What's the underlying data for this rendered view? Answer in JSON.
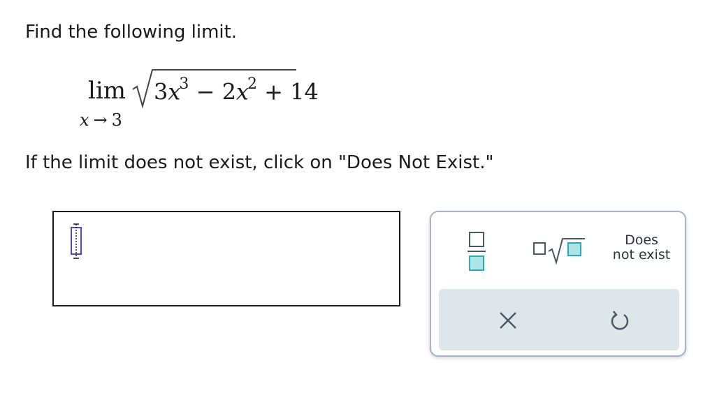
{
  "question": {
    "prompt": "Find the following limit.",
    "limit": {
      "operator": "lim",
      "variable": "x",
      "approach_symbol": "→",
      "approach_value": "3",
      "radicand": {
        "t1_coef": "3",
        "t1_var": "x",
        "t1_exp": "3",
        "op1": "−",
        "t2_coef": "2",
        "t2_var": "x",
        "t2_exp": "2",
        "op2": "+",
        "const": "14"
      }
    },
    "instruction": "If the limit does not exist, click on \"Does Not Exist.\""
  },
  "answer": {
    "value": ""
  },
  "palette": {
    "dne_line1": "Does",
    "dne_line2": "not exist",
    "accent_color": "#2fa8b3",
    "icon_color": "#4a5866",
    "tray_color": "#dfe6ea",
    "icons": [
      "fraction-icon",
      "root-icon",
      "clear-icon",
      "undo-icon"
    ]
  }
}
